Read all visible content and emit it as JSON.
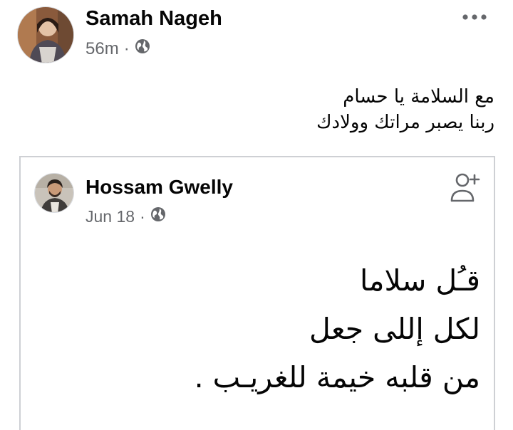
{
  "post": {
    "author": "Samah Nageh",
    "time": "56m",
    "separator": "·",
    "privacy_icon": "globe-icon",
    "more_icon": "more-horizontal-icon",
    "text_lines": [
      "مع السلامة يا حسام",
      "ربنا يصبر مراتك وولادك"
    ]
  },
  "shared_post": {
    "author": "Hossam Gwelly",
    "time": "Jun 18",
    "separator": "·",
    "privacy_icon": "globe-icon",
    "add_friend_icon": "add-friend-icon",
    "text_lines": [
      "قـُل سلاما",
      "لكل إللى جعل",
      "من قلبه خيمة للغريـب ."
    ]
  },
  "colors": {
    "text_primary": "#050505",
    "text_secondary": "#65676b",
    "card_border": "#ced0d4"
  }
}
